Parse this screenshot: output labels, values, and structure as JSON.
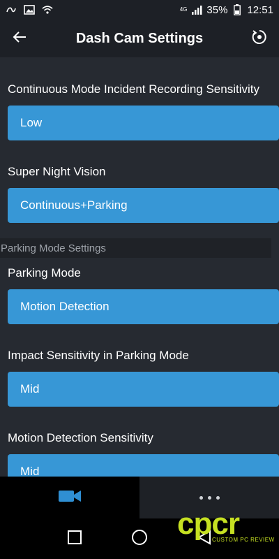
{
  "status_bar": {
    "network": "4G",
    "battery": "35%",
    "time": "12:51",
    "icons": [
      "link-icon",
      "image-icon",
      "wifi-icon",
      "signal-icon",
      "battery-icon"
    ]
  },
  "header": {
    "title": "Dash Cam Settings",
    "back_icon": "arrow-left-icon",
    "reset_icon": "reset-icon"
  },
  "settings": [
    {
      "label": "Continuous Mode Incident Recording Sensitivity",
      "value": "Low"
    },
    {
      "label": "Super Night Vision",
      "value": "Continuous+Parking"
    }
  ],
  "parking_section": {
    "title": "Parking Mode Settings",
    "items": [
      {
        "label": "Parking Mode",
        "value": "Motion Detection"
      },
      {
        "label": "Impact Sensitivity in Parking Mode",
        "value": "Mid"
      },
      {
        "label": "Motion Detection Sensitivity",
        "value": "Mid"
      }
    ]
  },
  "bottom_tabs": {
    "camera_icon": "video-camera-icon",
    "more_icon": "more-dots-icon"
  },
  "watermark": {
    "logo": "cpcr",
    "subtitle": "CUSTOM PC REVIEW"
  },
  "colors": {
    "background": "#262a31",
    "bar": "#1d2026",
    "accent": "#3797d6",
    "watermark": "#c6e022"
  }
}
